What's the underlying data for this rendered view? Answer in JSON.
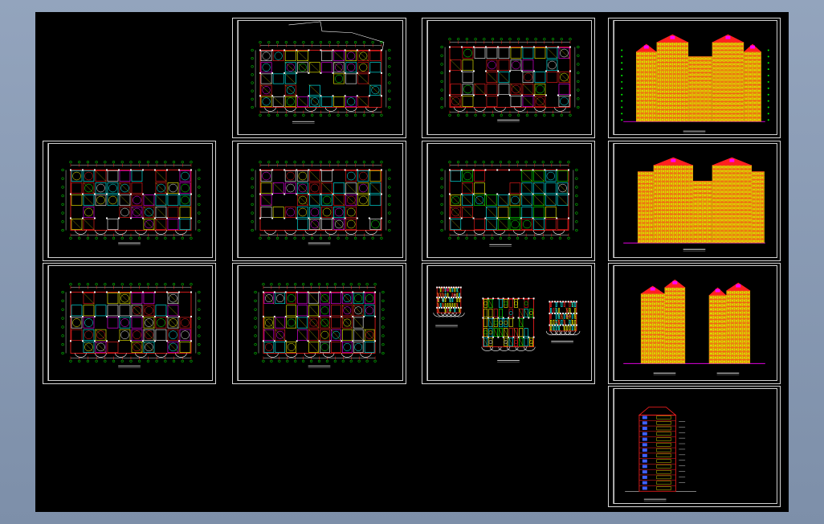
{
  "sheets": [
    {
      "id": "s1",
      "kind": "plan-twin",
      "caption": ""
    },
    {
      "id": "s2",
      "kind": "plan-twin",
      "caption": ""
    },
    {
      "id": "s3",
      "kind": "plan-roof",
      "caption": ""
    },
    {
      "id": "s4",
      "kind": "plan-twin",
      "caption": ""
    },
    {
      "id": "s5",
      "kind": "plan-twin-small",
      "caption": ""
    },
    {
      "id": "s6",
      "kind": "plan-dense",
      "caption": ""
    },
    {
      "id": "s7",
      "kind": "plan-cyan",
      "caption": ""
    },
    {
      "id": "s8",
      "kind": "details",
      "caption": ""
    },
    {
      "id": "s9",
      "kind": "elevation-front",
      "caption": ""
    },
    {
      "id": "s10",
      "kind": "elevation-back",
      "caption": ""
    },
    {
      "id": "s11",
      "kind": "elevation-side",
      "caption": ""
    },
    {
      "id": "s12",
      "kind": "section",
      "caption": ""
    }
  ],
  "colors": {
    "background": "#000000",
    "frame": "#d8d8d8",
    "red": "#ff2020",
    "yellow": "#ffff00",
    "cyan": "#00ffff",
    "green": "#00ff00",
    "white": "#ffffff",
    "magenta": "#ff00ff",
    "blue": "#4060ff"
  }
}
